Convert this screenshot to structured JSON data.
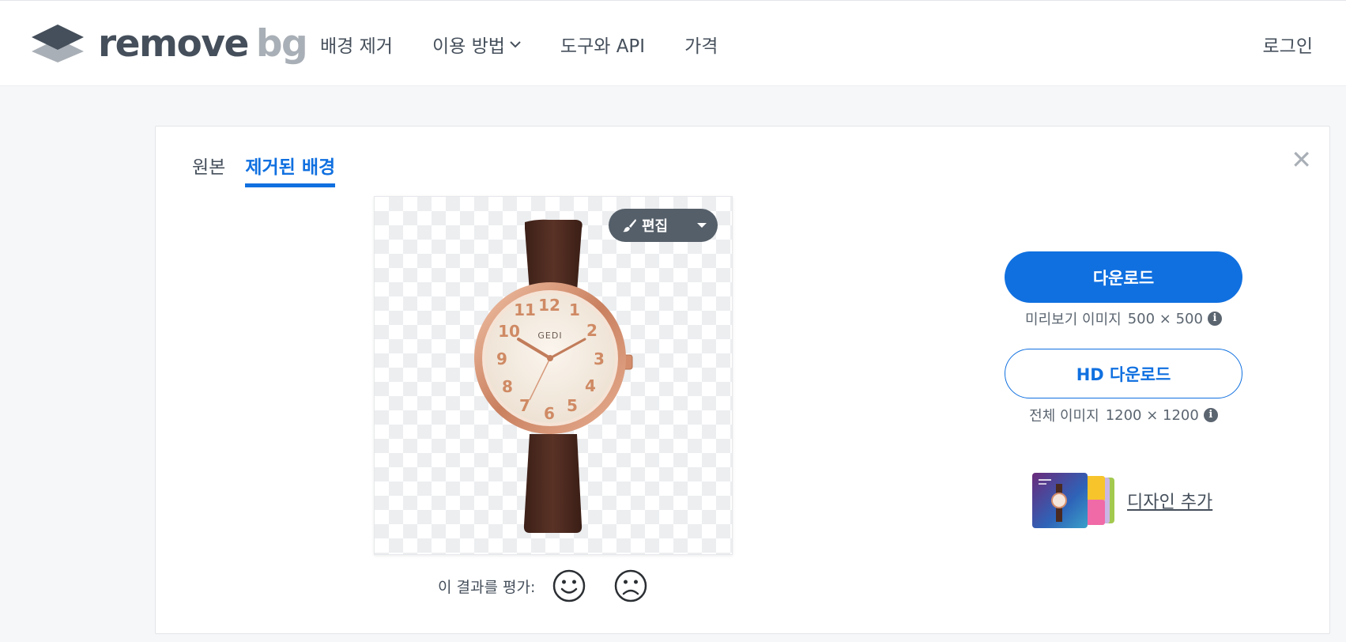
{
  "header": {
    "logo_word_1": "remove",
    "logo_word_2": "bg",
    "nav": [
      {
        "label": "배경 제거"
      },
      {
        "label": "이용 방법"
      },
      {
        "label": "도구와 API"
      },
      {
        "label": "가격"
      }
    ],
    "login_label": "로그인"
  },
  "card": {
    "tabs": [
      {
        "label": "원본",
        "active": false
      },
      {
        "label": "제거된 배경",
        "active": true
      }
    ],
    "close_label": "✕",
    "edit_label": "편집",
    "watch_brand": "GEDI",
    "watch_numbers": [
      "12",
      "1",
      "2",
      "3",
      "4",
      "5",
      "6",
      "7",
      "8",
      "9",
      "10",
      "11"
    ],
    "rate_label": "이 결과를 평가:",
    "download_label": "다운로드",
    "preview_info": {
      "label": "미리보기 이미지",
      "size": "500 × 500"
    },
    "hd_download_label": "HD 다운로드",
    "full_info": {
      "label": "전체 이미지",
      "size": "1200 × 1200"
    },
    "add_design_label": "디자인 추가"
  },
  "colors": {
    "accent": "#1070e0",
    "text": "#454f5b",
    "edit_button": "#555f69",
    "strap": "#4e2b20",
    "rose_gold": "#d9977a"
  },
  "icons": [
    "logo-layers-icon",
    "chevron-down-icon",
    "close-icon",
    "brush-icon",
    "caret-down-icon",
    "smiley-face-icon",
    "frown-face-icon",
    "info-icon"
  ]
}
